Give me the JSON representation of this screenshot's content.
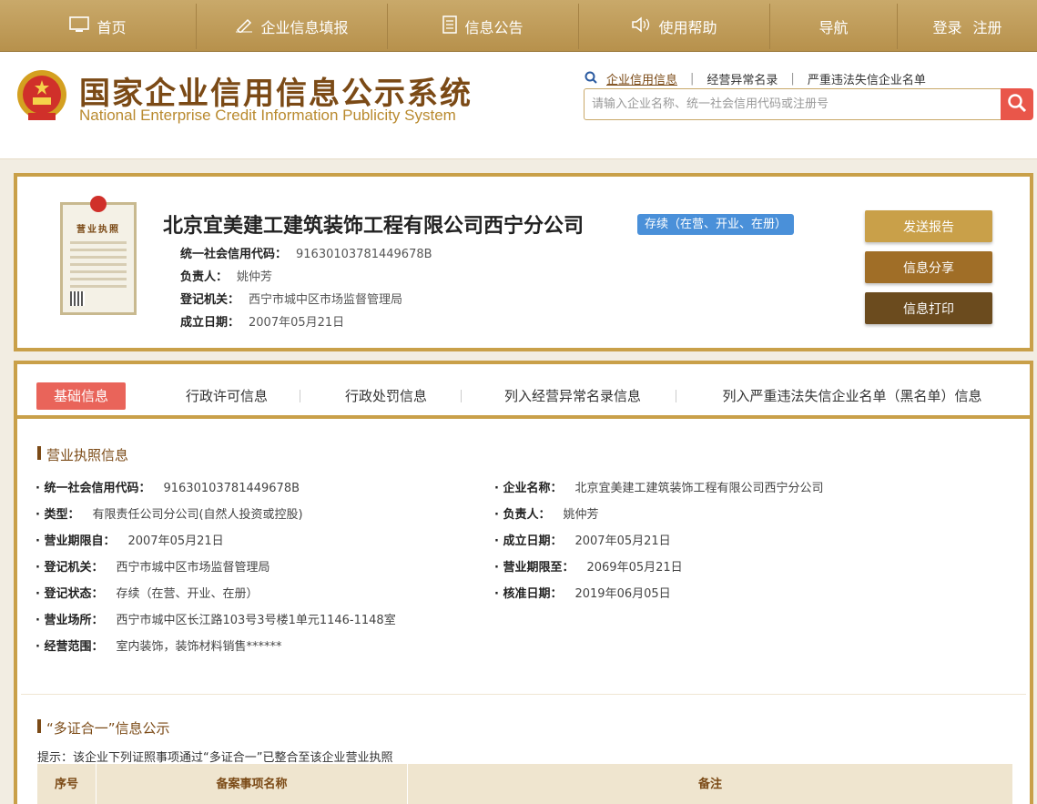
{
  "nav": {
    "home": "首页",
    "fill": "企业信息填报",
    "notice": "信息公告",
    "help": "使用帮助",
    "guide": "导航",
    "login": "登录",
    "register": "注册"
  },
  "header": {
    "title": "国家企业信用信息公示系统",
    "subtitle": "National Enterprise Credit Information Publicity System",
    "search_tabs": [
      "企业信用信息",
      "经营异常名录",
      "严重违法失信企业名单"
    ],
    "search_placeholder": "请输入企业名称、统一社会信用代码或注册号"
  },
  "company": {
    "name": "北京宜美建工建筑装饰工程有限公司西宁分公司",
    "status": "存续（在营、开业、在册）",
    "license_label": "营业执照",
    "meta": [
      {
        "k": "统一社会信用代码：",
        "v": "91630103781449678B"
      },
      {
        "k": "负责人：",
        "v": "姚仲芳"
      },
      {
        "k": "登记机关：",
        "v": "西宁市城中区市场监督管理局"
      },
      {
        "k": "成立日期：",
        "v": "2007年05月21日"
      }
    ],
    "buttons": {
      "send": "发送报告",
      "share": "信息分享",
      "print": "信息打印"
    }
  },
  "tabs": [
    "基础信息",
    "行政许可信息",
    "行政处罚信息",
    "列入经营异常名录信息",
    "列入严重违法失信企业名单（黑名单）信息"
  ],
  "license_section": {
    "title": "营业执照信息",
    "left": [
      {
        "k": "统一社会信用代码：",
        "v": "91630103781449678B"
      },
      {
        "k": "类型：",
        "v": "有限责任公司分公司(自然人投资或控股)"
      },
      {
        "k": "营业期限自：",
        "v": "2007年05月21日"
      },
      {
        "k": "登记机关：",
        "v": "西宁市城中区市场监督管理局"
      },
      {
        "k": "登记状态：",
        "v": "存续（在营、开业、在册）"
      },
      {
        "k": "营业场所：",
        "v": "西宁市城中区长江路103号3号楼1单元1146-1148室"
      },
      {
        "k": "经营范围：",
        "v": "室内装饰，装饰材料销售******"
      }
    ],
    "right": [
      {
        "k": "企业名称：",
        "v": "北京宜美建工建筑装饰工程有限公司西宁分公司"
      },
      {
        "k": "负责人：",
        "v": "姚仲芳"
      },
      {
        "k": "成立日期：",
        "v": "2007年05月21日"
      },
      {
        "k": "营业期限至：",
        "v": "2069年05月21日"
      },
      {
        "k": "核准日期：",
        "v": "2019年06月05日"
      }
    ]
  },
  "multi_cert": {
    "title": "“多证合一”信息公示",
    "tip": "提示：该企业下列证照事项通过“多证合一”已整合至该企业营业执照",
    "columns": [
      "序号",
      "备案事项名称",
      "备注"
    ]
  },
  "colors": {
    "gold": "#c9a049",
    "brown": "#7b4a16",
    "accent_red": "#e9645a",
    "status_blue": "#4a90d9"
  }
}
